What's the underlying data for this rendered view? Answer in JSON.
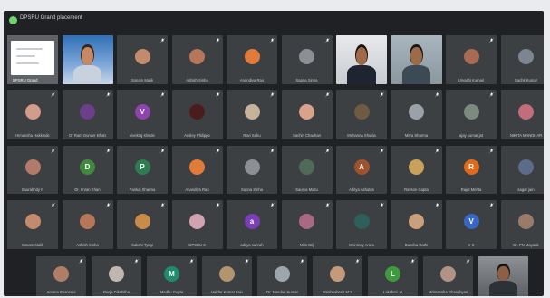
{
  "meeting": {
    "title": "DPSRU Grand placement",
    "accent": "#6ed36e"
  },
  "rows": [
    [
      {
        "name": "DPSRU Grand",
        "type": "slide"
      },
      {
        "name": "",
        "type": "video-woman"
      },
      {
        "name": "Sonam Malik",
        "initial": "",
        "color": "#c28b6e"
      },
      {
        "name": "Ashish Sinha",
        "initial": "",
        "color": "#b5765a"
      },
      {
        "name": "Anandiya Rao",
        "initial": "",
        "color": "#e07b39"
      },
      {
        "name": "Sapna Sinha",
        "initial": "",
        "color": "#8c8f94"
      },
      {
        "name": "",
        "type": "video-man1"
      },
      {
        "name": "",
        "type": "video-man2"
      },
      {
        "name": "Urvashi Kumari",
        "initial": "",
        "color": "#a76b55"
      },
      {
        "name": "Sachit Kumar",
        "initial": "",
        "color": "#7d8590"
      }
    ],
    [
      {
        "name": "Himanshu Hakkinde",
        "initial": "",
        "color": "#d29c8a"
      },
      {
        "name": "Dr Ram Gunder Bhatt",
        "initial": "",
        "color": "#6b3f8a"
      },
      {
        "name": "vivekraj shinde",
        "initial": "V",
        "color": "#8e44ad"
      },
      {
        "name": "Ansley Philippe",
        "initial": "",
        "color": "#4b1c1c"
      },
      {
        "name": "Ravi Sahu",
        "initial": "",
        "color": "#c7b39a"
      },
      {
        "name": "Sachin Chauhan",
        "initial": "",
        "color": "#d8a38a"
      },
      {
        "name": "Mohanna Shukla",
        "initial": "",
        "color": "#6f5a42"
      },
      {
        "name": "Mitra Sharma",
        "initial": "",
        "color": "#9aa1a8"
      },
      {
        "name": "ajay kumar jat",
        "initial": "",
        "color": "#7c8a80"
      },
      {
        "name": "NIKITA MANDHAR",
        "initial": "",
        "color": "#c26d7a"
      }
    ],
    [
      {
        "name": "Saurabhdy N",
        "initial": "",
        "color": "#b17a69"
      },
      {
        "name": "Dr. Imran Khan",
        "initial": "D",
        "color": "#3f8a3f"
      },
      {
        "name": "Pankaj Sharma",
        "initial": "P",
        "color": "#2e7d52"
      },
      {
        "name": "Anandiya Rao",
        "initial": "",
        "color": "#e07b39"
      },
      {
        "name": "Sapna Sinha",
        "initial": "",
        "color": "#8c8f94"
      },
      {
        "name": "Saurya Mazu",
        "initial": "",
        "color": "#4f6b58"
      },
      {
        "name": "Aditya Ashutos",
        "initial": "A",
        "color": "#a0522d"
      },
      {
        "name": "Ravson Gupta",
        "initial": "",
        "color": "#c9a15a"
      },
      {
        "name": "Rajat Mehta",
        "initial": "R",
        "color": "#e06a1b"
      },
      {
        "name": "sagar jain",
        "initial": "",
        "color": "#5d6b8a"
      }
    ],
    [
      {
        "name": "Sonam Malik",
        "initial": "",
        "color": "#c28b6e"
      },
      {
        "name": "Ashish Sinha",
        "initial": "",
        "color": "#b5765a"
      },
      {
        "name": "Sakshi Tyagi",
        "initial": "",
        "color": "#c98b4a"
      },
      {
        "name": "DPSRU 3",
        "initial": "",
        "color": "#d1a3b0"
      },
      {
        "name": "aditya sahrah",
        "initial": "a",
        "color": "#7b3fb5"
      },
      {
        "name": "Nitin Brij",
        "initial": "",
        "color": "#a86a80"
      },
      {
        "name": "Chinmay Arora",
        "initial": "",
        "color": "#2f5f5a"
      },
      {
        "name": "Bandna Rathi",
        "initial": "",
        "color": "#caa07c"
      },
      {
        "name": "V S",
        "initial": "V",
        "color": "#3a66c4"
      },
      {
        "name": "Dr. PN Mayank",
        "initial": "",
        "color": "#9a7b6a"
      }
    ],
    [
      {
        "name": "Amana Bharwani",
        "initial": "",
        "color": "#b07e66"
      },
      {
        "name": "Pooja Dikshitha",
        "initial": "",
        "color": "#bfb7b0"
      },
      {
        "name": "Madhu Gupta",
        "initial": "M",
        "color": "#1e8c6e"
      },
      {
        "name": "Haldar Kumar Jain",
        "initial": "",
        "color": "#b2946e"
      },
      {
        "name": "Dr. Nandan Kumar",
        "initial": "",
        "color": "#9ea5ad"
      },
      {
        "name": "Baishnabesh M.S",
        "initial": "",
        "color": "#c49a7c"
      },
      {
        "name": "Lakshmi. N",
        "initial": "L",
        "color": "#3f9a3f"
      },
      {
        "name": "Mrimansha Ghanshyam",
        "initial": "",
        "color": "#b39286"
      },
      {
        "name": "",
        "type": "video-man3"
      }
    ]
  ]
}
